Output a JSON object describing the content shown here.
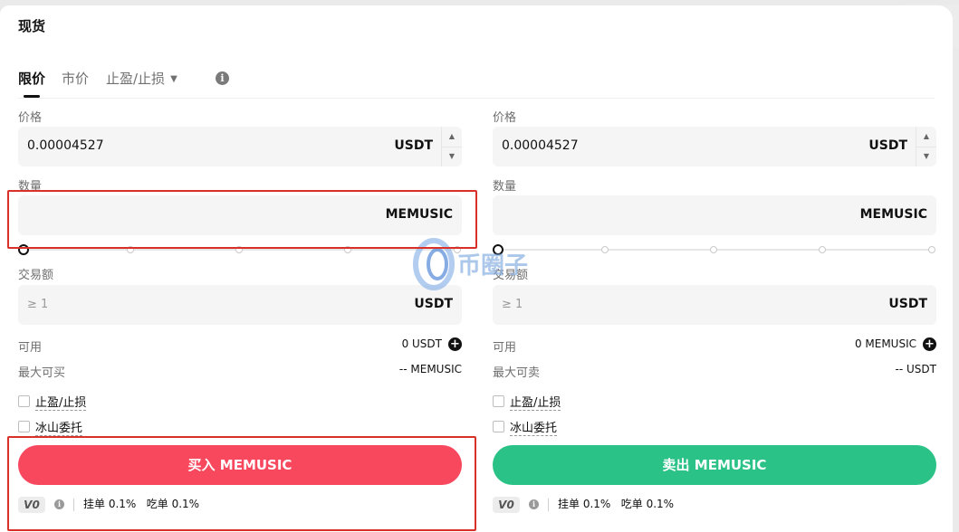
{
  "panel": {
    "title": "现货"
  },
  "tabs": [
    {
      "label": "限价",
      "active": true
    },
    {
      "label": "市价",
      "active": false
    },
    {
      "label": "止盈/止损",
      "active": false
    }
  ],
  "buy": {
    "price_label": "价格",
    "price_value": "0.00004527",
    "price_unit": "USDT",
    "qty_label": "数量",
    "qty_unit": "MEMUSIC",
    "slider_percent": 0,
    "amount_label": "交易额",
    "amount_placeholder": "≥ 1",
    "amount_unit": "USDT",
    "available_label": "可用",
    "available_value": "0 USDT",
    "max_label": "最大可买",
    "max_value": "-- MEMUSIC",
    "tpsl_label": "止盈/止损",
    "iceberg_label": "冰山委托",
    "button_label": "买入 MEMUSIC",
    "vip": "V0",
    "maker_fee": "挂单 0.1%",
    "taker_fee": "吃单 0.1%"
  },
  "sell": {
    "price_label": "价格",
    "price_value": "0.00004527",
    "price_unit": "USDT",
    "qty_label": "数量",
    "qty_unit": "MEMUSIC",
    "slider_percent": 0,
    "amount_label": "交易额",
    "amount_placeholder": "≥ 1",
    "amount_unit": "USDT",
    "available_label": "可用",
    "available_value": "0 MEMUSIC",
    "max_label": "最大可卖",
    "max_value": "-- USDT",
    "tpsl_label": "止盈/止损",
    "iceberg_label": "冰山委托",
    "button_label": "卖出 MEMUSIC",
    "vip": "V0",
    "maker_fee": "挂单 0.1%",
    "taker_fee": "吃单 0.1%"
  },
  "watermark": {
    "text": "币圈子"
  },
  "colors": {
    "buy": "#f7485e",
    "sell": "#2bc287",
    "highlight": "#d9302a"
  },
  "icons": [
    "robot-icon",
    "menu-icon",
    "info-icon",
    "plus-circle-icon",
    "caret-down-icon"
  ]
}
